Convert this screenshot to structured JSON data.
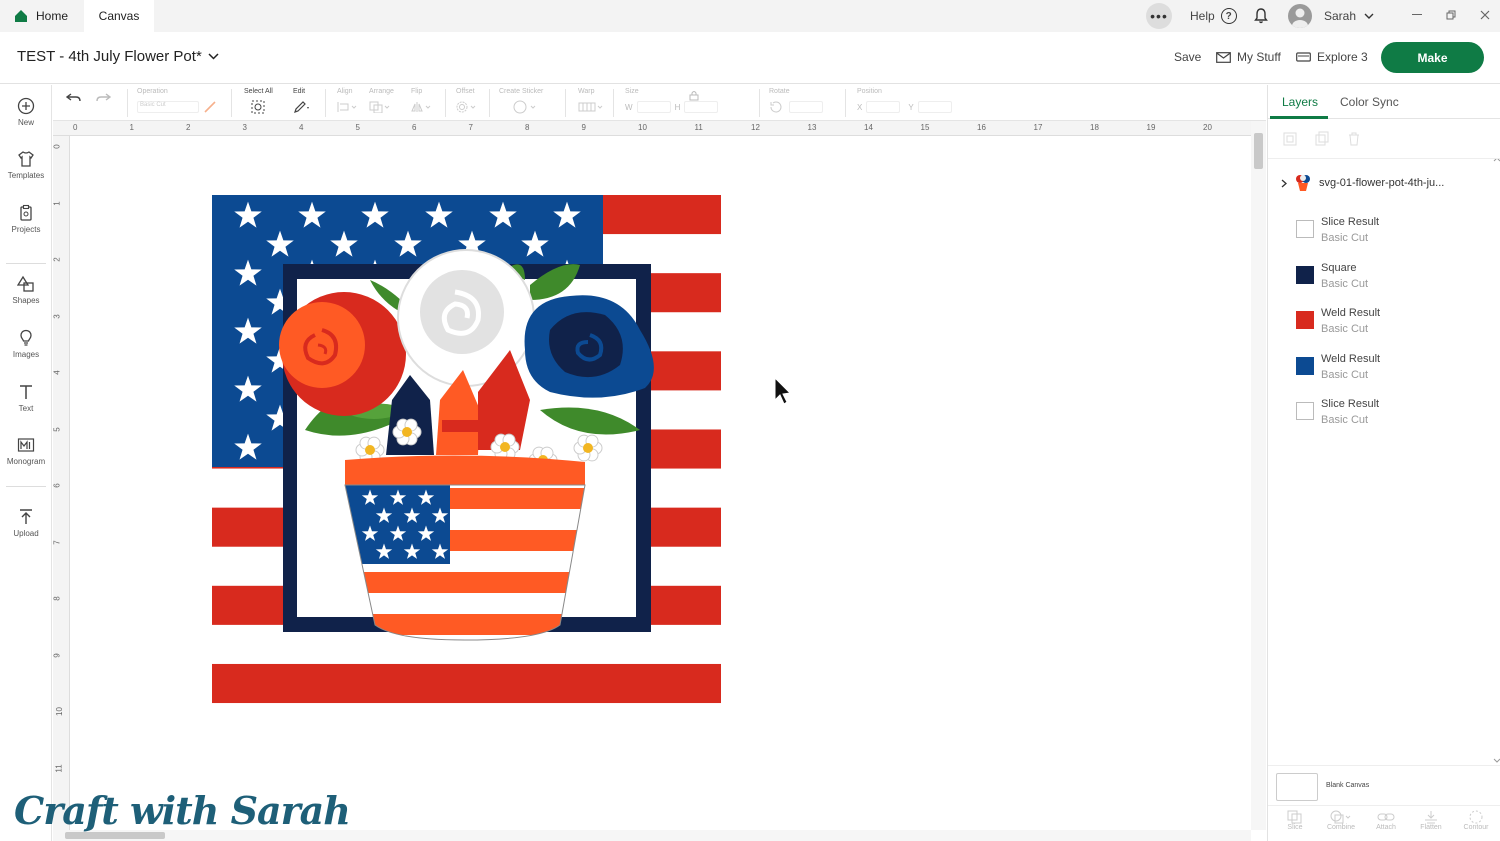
{
  "tabs": {
    "home": "Home",
    "canvas": "Canvas"
  },
  "topbar": {
    "more": "•••",
    "help": "Help",
    "help_mark": "?",
    "user": "Sarah"
  },
  "header": {
    "project_title": "TEST - 4th July Flower Pot*",
    "save": "Save",
    "my_stuff": "My Stuff",
    "machine": "Explore 3",
    "make": "Make"
  },
  "left_rail": {
    "new": "New",
    "templates": "Templates",
    "projects": "Projects",
    "shapes": "Shapes",
    "images": "Images",
    "text": "Text",
    "monogram": "Monogram",
    "upload": "Upload"
  },
  "toolbar": {
    "operation_label": "Operation",
    "operation_value": "Basic Cut",
    "select_all": "Select All",
    "edit": "Edit",
    "align": "Align",
    "arrange": "Arrange",
    "flip": "Flip",
    "offset": "Offset",
    "create_sticker": "Create Sticker",
    "warp": "Warp",
    "size": "Size",
    "w": "W",
    "h": "H",
    "rotate": "Rotate",
    "position": "Position",
    "x": "X",
    "y": "Y"
  },
  "ruler": {
    "top": [
      "0",
      "1",
      "2",
      "3",
      "4",
      "5",
      "6",
      "7",
      "8",
      "9",
      "10",
      "11",
      "12",
      "13",
      "14",
      "15",
      "16",
      "17",
      "18",
      "19",
      "20"
    ],
    "left": [
      "0",
      "1",
      "2",
      "3",
      "4",
      "5",
      "6",
      "7",
      "8",
      "9",
      "10",
      "11"
    ]
  },
  "panel": {
    "tab_layers": "Layers",
    "tab_color_sync": "Color Sync",
    "group_name": "svg-01-flower-pot-4th-ju...",
    "layers": [
      {
        "name": "Slice Result",
        "op": "Basic Cut",
        "color": "#ffffff"
      },
      {
        "name": "Square",
        "op": "Basic Cut",
        "color": "#10224a"
      },
      {
        "name": "Weld Result",
        "op": "Basic Cut",
        "color": "#d82a1e"
      },
      {
        "name": "Weld Result",
        "op": "Basic Cut",
        "color": "#0c4a92"
      },
      {
        "name": "Slice Result",
        "op": "Basic Cut",
        "color": "#ffffff"
      }
    ],
    "blank_canvas": "Blank Canvas",
    "bottom_actions": [
      "Slice",
      "Combine",
      "Attach",
      "Flatten",
      "Contour"
    ]
  },
  "colors": {
    "accent": "#0f7b45",
    "flag_red": "#d82a1e",
    "flag_blue": "#0c4a92",
    "navy": "#10224a",
    "orange": "#ff5a24"
  },
  "watermark": "Craft with Sarah"
}
